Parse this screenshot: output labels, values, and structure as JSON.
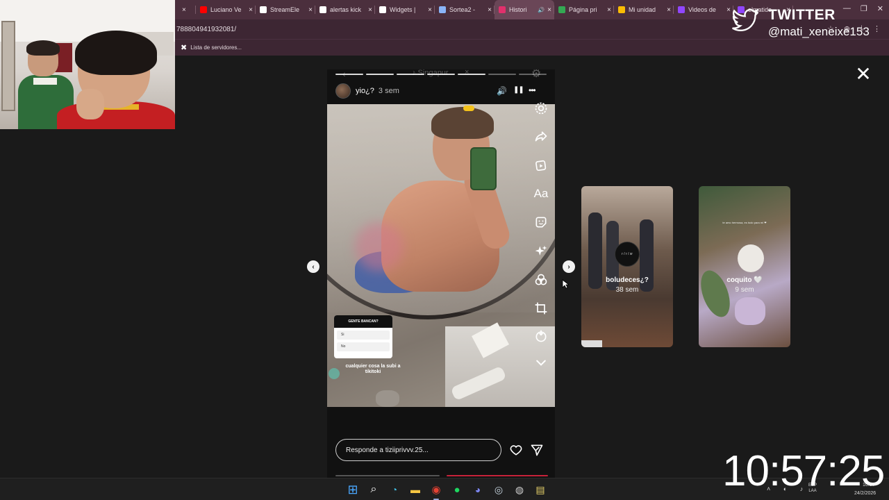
{
  "browser": {
    "tabs": [
      {
        "label": "",
        "icon": "close-icon",
        "color": "#4b2f3d"
      },
      {
        "label": "Luciano Ve",
        "icon": "youtube-icon",
        "color": "#ff0000"
      },
      {
        "label": "StreamEle",
        "icon": "anchor-icon",
        "color": "#ffffff"
      },
      {
        "label": "alertas kick",
        "icon": "google-icon",
        "color": "#ffffff"
      },
      {
        "label": "Widgets |",
        "icon": "diamond-icon",
        "color": "#ffffff"
      },
      {
        "label": "Sortea2 -",
        "icon": "trophy-icon",
        "color": "#8ab4f8"
      },
      {
        "label": "Histori",
        "icon": "instagram-icon",
        "color": "#e1306c",
        "active": true,
        "audio": "🔊"
      },
      {
        "label": "Página pri",
        "icon": "drive-icon",
        "color": "#34a853"
      },
      {
        "label": "Mi unidad",
        "icon": "drive-icon",
        "color": "#fbbc04"
      },
      {
        "label": "Videos de",
        "icon": "twitch-icon",
        "color": "#9146ff"
      },
      {
        "label": "elmatide",
        "icon": "twitch-icon",
        "color": "#9146ff"
      }
    ],
    "tab_close": "×",
    "window_controls": [
      "—",
      "❐",
      "✕"
    ],
    "url_fragment": "788804941932081/",
    "address_icons": [
      "☆",
      "⊕",
      "⤓",
      "⋮"
    ],
    "bookmark_label": "Lista de servidores..."
  },
  "twitter_overlay": {
    "title": "TWITTER",
    "handle": "@mati_xeneixe153"
  },
  "story": {
    "top_faded": {
      "back": "‹",
      "location": "♪ Singapur",
      "close": "×"
    },
    "progress_segments": [
      1,
      1,
      1,
      1,
      1,
      0,
      0
    ],
    "username": "yio¿?",
    "time_ago": "3 sem",
    "controls": {
      "sound": "🔊",
      "pause": "❚❚",
      "more": "•••"
    },
    "poll": {
      "question": "GENTE BANCAN?",
      "options": [
        "Si",
        "No"
      ]
    },
    "caption": "cualquier cosa la subi a tikitoki",
    "side_tools": [
      "settings-icon",
      "share-arrow-icon",
      "sticker-icon",
      "text-tool-icon",
      "face-sticker-icon",
      "sparkle-icon",
      "filters-icon",
      "crop-icon",
      "draw-icon",
      "chevron-down-icon"
    ],
    "text_tool_label": "Aa",
    "reply_placeholder": "Responde a tiziiprivvv.25..."
  },
  "previews": [
    {
      "title": "boludeces¿?",
      "time": "38 sem",
      "avatar_text": "r / r / xr",
      "color": "#5c4a3e"
    },
    {
      "title": "coquito 🤍",
      "time": "9 sem",
      "note": "te amo hermosa, es todo para mi ❤",
      "color": "#6f5c4a"
    }
  ],
  "viewer_controls": {
    "close": "✕",
    "prev": "‹",
    "next": "›"
  },
  "clock": "10:57:25",
  "taskbar": {
    "apps": [
      "windows-start-icon",
      "search-icon",
      "edge-icon",
      "file-explorer-icon",
      "chrome-icon",
      "spotify-icon",
      "discord-icon",
      "steam-icon",
      "obs-icon",
      "notes-icon"
    ],
    "lang": "ESP\nLAA",
    "time": "10:57",
    "date": "24/2/2026"
  }
}
